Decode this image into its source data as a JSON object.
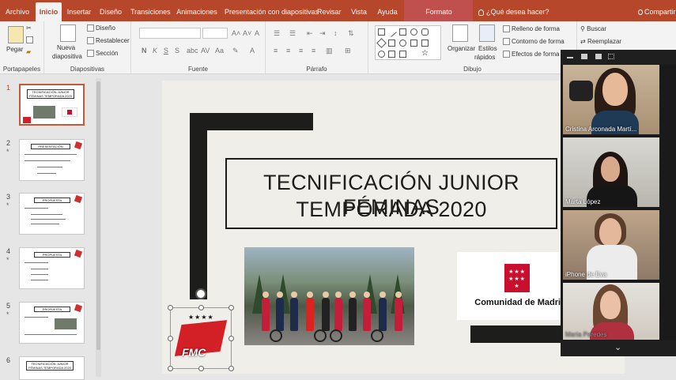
{
  "tabs": [
    {
      "label": "Archivo",
      "active": false
    },
    {
      "label": "Inicio",
      "active": true
    },
    {
      "label": "Insertar",
      "active": false
    },
    {
      "label": "Diseño",
      "active": false
    },
    {
      "label": "Transiciones",
      "active": false
    },
    {
      "label": "Animaciones",
      "active": false
    },
    {
      "label": "Presentación con diapositivas",
      "active": false
    },
    {
      "label": "Revisar",
      "active": false
    },
    {
      "label": "Vista",
      "active": false
    },
    {
      "label": "Ayuda",
      "active": false
    },
    {
      "label": "Formato",
      "active": false
    }
  ],
  "tellme": "¿Qué desea hacer?",
  "share": "Compartir",
  "ribbon": {
    "portapapeles": {
      "label": "Portapapeles",
      "paste": "Pegar"
    },
    "diapositivas": {
      "label": "Diapositivas",
      "new_slide": "Nueva",
      "new_slide2": "diapositiva",
      "layout": "Diseño",
      "reset": "Restablecer",
      "section": "Sección"
    },
    "fuente": {
      "label": "Fuente",
      "bold": "N",
      "italic": "K",
      "underline": "S",
      "strike": "S",
      "spacing": "AV",
      "case": "Aa",
      "color": "A"
    },
    "parrafo": {
      "label": "Párrafo"
    },
    "dibujo": {
      "label": "Dibujo",
      "arrange": "Organizar",
      "styles": "Estilos",
      "styles2": "rápidos",
      "fill": "Relleno de forma",
      "outline": "Contorno de forma",
      "effects": "Efectos de forma"
    },
    "edicion": {
      "find": "Buscar",
      "replace": "Reemplazar"
    }
  },
  "thumbnails": [
    {
      "num": "1",
      "title": "TECNIFICACIÓN JUNIOR FÉMINAS TEMPORADA 2020",
      "selected": true,
      "star": ""
    },
    {
      "num": "2",
      "title": "PRESENTACIÓN",
      "selected": false,
      "star": "*"
    },
    {
      "num": "3",
      "title": "PROPUESTA",
      "selected": false,
      "star": "*"
    },
    {
      "num": "4",
      "title": "PROPUESTA",
      "selected": false,
      "star": "*"
    },
    {
      "num": "5",
      "title": "PROPUESTA",
      "selected": false,
      "star": "*"
    },
    {
      "num": "6",
      "title": "TECNIFICACIÓN JUNIOR FÉMINAS TEMPORADA 2020",
      "selected": false,
      "star": ""
    }
  ],
  "slide": {
    "title_line1": "TECNIFICACIÓN JUNIOR FÉMINAS",
    "title_line2": "TEMPORADA 2020",
    "org_name": "Comunidad de Madrid",
    "club_logo_text": "FMC"
  },
  "participants": [
    {
      "name": "Cristina Arconada Martí..."
    },
    {
      "name": "Marta López"
    },
    {
      "name": "iPhone de Eva"
    },
    {
      "name": "María Paredes"
    }
  ],
  "colors": {
    "accent": "#b7472a",
    "slide_bg": "#f0eee9",
    "dark": "#1d1d1b"
  }
}
